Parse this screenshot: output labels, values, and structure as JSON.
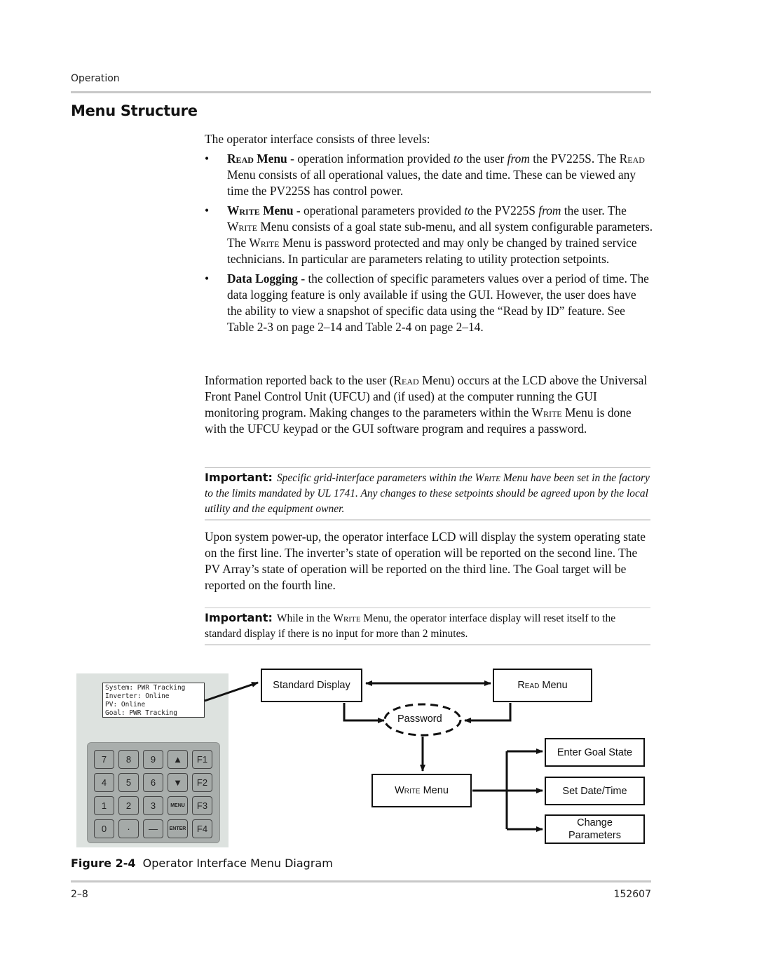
{
  "header": {
    "section": "Operation"
  },
  "title": "Menu Structure",
  "intro": "The operator interface consists of three levels:",
  "bullets": [
    {
      "term_sc": "Read",
      "term_rest": " Menu",
      "dash": " - operation information provided ",
      "i1": "to",
      "mid": " the user ",
      "i2": "from",
      "tail": " the PV225S.",
      "line2a": " The ",
      "line2_sc": "Read",
      "line2b": " Menu consists of all operational values, the date and time. These can be viewed any time the PV225S has control power."
    },
    {
      "term_sc": "Write",
      "term_rest": " Menu",
      "dash": " - operational parameters provided ",
      "i1": "to",
      "mid": " the PV225S ",
      "i2": "from",
      "tail": " the user.",
      "line2a": " The ",
      "line2_sc": "Write",
      "line2b": " Menu consists of a goal state sub-menu, and all system configurable parameters. The ",
      "line3_sc": "Write",
      "line3b": " Menu is password protected and may only be changed by trained service technicians. In particular are parameters relating to utility protection setpoints."
    },
    {
      "term": "Data Logging",
      "text": " - the collection of specific parameters values over a period of time. The data logging feature is only available if using the GUI. However, the user does have the ability to view a snapshot of specific data using the “Read by ID” feature. See Table 2-3 on page 2–14 and Table 2-4 on page 2–14."
    }
  ],
  "para2": {
    "a": "Information reported back to the user (",
    "sc1": "Read",
    "b": " Menu) occurs at the LCD above the Universal Front Panel Control Unit (UFCU) and (if used) at the computer running the GUI monitoring program. Making changes to the parameters within the ",
    "sc2": "Write",
    "c": " Menu is done with the UFCU keypad or the GUI software program and requires a password."
  },
  "important1": {
    "label": "Important:",
    "a": "Specific grid-interface parameters within the ",
    "sc": "Write",
    "b": " Menu have been set in the factory to the limits mandated by UL 1741. Any changes to these setpoints should be agreed upon by the local utility and the equipment owner."
  },
  "para3": "Upon system power-up, the operator interface LCD will display the system operating state on the first line. The inverter’s state of operation will be reported on the second line. The PV Array’s state of operation will be reported on the third line. The Goal target will be reported on the fourth line.",
  "important2": {
    "label": "Important:",
    "a": "While in the ",
    "sc": "Write",
    "b": " Menu, the operator interface display will reset itself to the standard display if there is no input for more than 2 minutes."
  },
  "lcd_lines": [
    "System: PWR Tracking",
    "Inverter: Online",
    "PV: Online",
    "Goal: PWR Tracking"
  ],
  "keypad": [
    [
      "7",
      "8",
      "9",
      "▲",
      "F1"
    ],
    [
      "4",
      "5",
      "6",
      "▼",
      "F2"
    ],
    [
      "1",
      "2",
      "3",
      "MENU",
      "F3"
    ],
    [
      "0",
      "·",
      "—",
      "ENTER",
      "F4"
    ]
  ],
  "diagram": {
    "standard_display": "Standard Display",
    "read_menu_sc": "Read",
    "read_menu_rest": " Menu",
    "password": "Password",
    "write_menu_sc": "Write",
    "write_menu_rest": " Menu",
    "enter_goal_state": "Enter Goal State",
    "set_date_time": "Set Date/Time",
    "change_parameters_1": "Change",
    "change_parameters_2": "Parameters"
  },
  "caption": {
    "figure": "Figure 2-4",
    "text": "Operator Interface Menu Diagram"
  },
  "footer": {
    "page": "2–8",
    "doc_number": "152607"
  }
}
